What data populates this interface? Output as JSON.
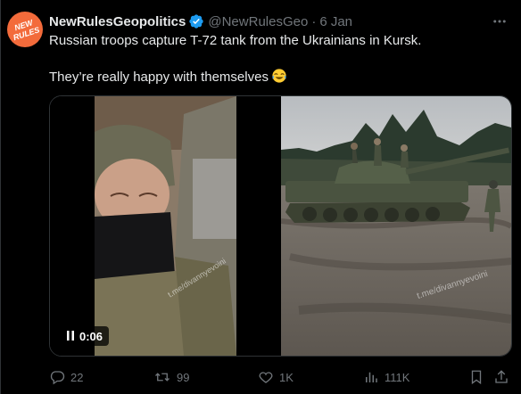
{
  "tweet": {
    "author_name": "NewRulesGeopolitics",
    "handle": "@NewRulesGeo",
    "separator": "·",
    "date": "6 Jan",
    "text_line1": "Russian troops capture T-72 tank from the Ukrainians in Kursk.",
    "text_line2": "They’re really happy with themselves",
    "avatar_text": "NEW RULES"
  },
  "media": {
    "video_time": "0:06",
    "watermark_left": "t.me/divannyevoini",
    "watermark_right": "t.me/divannyevoini"
  },
  "actions": {
    "replies": "22",
    "reposts": "99",
    "likes": "1K",
    "views": "111K"
  },
  "colors": {
    "background": "#000000",
    "text": "#e7e9ea",
    "muted": "#71767b",
    "verified": "#1d9bf0",
    "avatar": "#f36b3b"
  }
}
